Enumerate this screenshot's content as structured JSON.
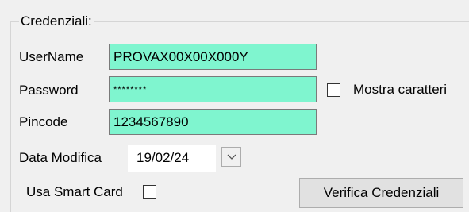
{
  "group": {
    "title": "Credenziali:"
  },
  "username": {
    "label": "UserName",
    "value": "PROVAX00X00X000Y"
  },
  "password": {
    "label": "Password",
    "value": "********"
  },
  "show_chars": {
    "label": "Mostra caratteri",
    "checked": false
  },
  "pincode": {
    "label": "Pincode",
    "value": "1234567890"
  },
  "data_modifica": {
    "label": "Data Modifica",
    "value": "19/02/24"
  },
  "smart_card": {
    "label": "Usa Smart Card",
    "checked": false
  },
  "verify_button": {
    "label": "Verifica Credenziali"
  },
  "colors": {
    "field_background": "#7ff5cf",
    "window_background": "#f0f0f0"
  },
  "icons": {
    "date_dropdown": "chevron-down-icon"
  }
}
